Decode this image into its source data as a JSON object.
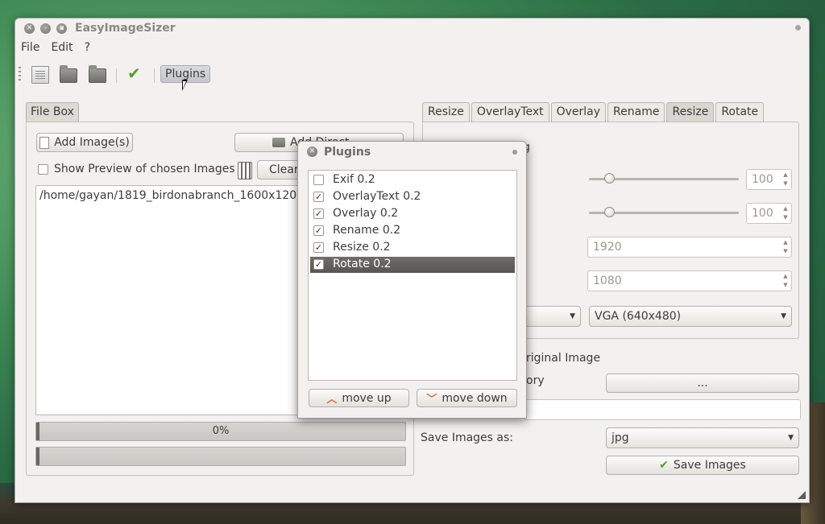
{
  "app": {
    "title": "EasyImageSizer"
  },
  "menu": {
    "items": [
      {
        "label": "File"
      },
      {
        "label": "Edit"
      },
      {
        "label": "?"
      }
    ]
  },
  "toolbar": {
    "plugins_label": "Plugins"
  },
  "filebox": {
    "tab_label": "File Box",
    "add_images_label": "Add Image(s)",
    "add_directory_label": "Add Direct",
    "show_preview_label": "Show Preview of chosen Images",
    "clear_label": "Clear",
    "files": [
      "/home/gayan/1819_birdonabranch_1600x1200.jpg"
    ],
    "progress_1_text": "0%",
    "progress_1_value": 0,
    "progress_2_value": 0
  },
  "tabs": [
    {
      "label": "Resize",
      "active": false
    },
    {
      "label": "OverlayText",
      "active": false
    },
    {
      "label": "Overlay",
      "active": false
    },
    {
      "label": "Rename",
      "active": false
    },
    {
      "label": "Resize",
      "active": true
    },
    {
      "label": "Rotate",
      "active": false
    }
  ],
  "resize_panel": {
    "partial_heading": "g",
    "slider_1_value": "100",
    "slider_2_value": "100",
    "width_value": "1920",
    "height_value": "1080",
    "preset_value": "VGA (640x480)",
    "keep_original_label": "riginal Image",
    "directory_label": "ory",
    "browse_label": "...",
    "save_as_label": "Save Images as:",
    "format_value": "jpg",
    "save_button_label": "Save Images"
  },
  "plugins_dialog": {
    "title": "Plugins",
    "items": [
      {
        "label": "Exif 0.2",
        "checked": false,
        "selected": false
      },
      {
        "label": "OverlayText 0.2",
        "checked": true,
        "selected": false
      },
      {
        "label": "Overlay 0.2",
        "checked": true,
        "selected": false
      },
      {
        "label": "Rename 0.2",
        "checked": true,
        "selected": false
      },
      {
        "label": "Resize 0.2",
        "checked": true,
        "selected": false
      },
      {
        "label": "Rotate 0.2",
        "checked": true,
        "selected": true
      }
    ],
    "move_up_label": "move up",
    "move_down_label": "move down"
  },
  "colors": {
    "accent_check": "#5c9b2c",
    "arrow": "#e06a2c",
    "selection": "#575652"
  }
}
